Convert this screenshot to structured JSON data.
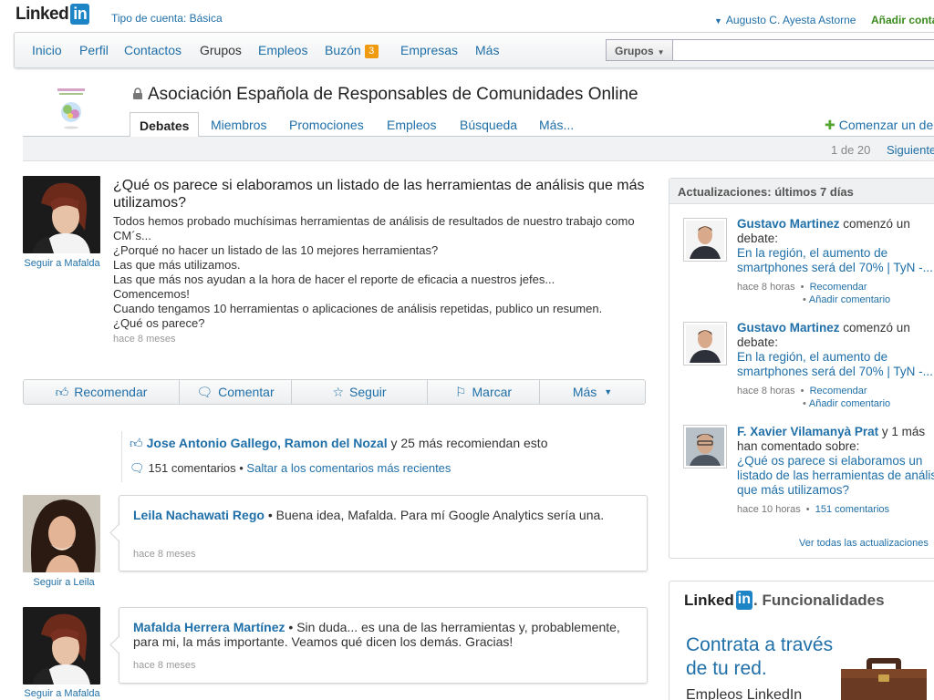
{
  "header": {
    "logo_text": "Linked",
    "logo_in": "in",
    "account_type": "Tipo de cuenta: Básica",
    "user_name": "Augusto C. Ayesta Astorne",
    "add_contacts": "Añadir conta"
  },
  "nav": {
    "items": [
      "Inicio",
      "Perfil",
      "Contactos",
      "Grupos",
      "Empleos",
      "Buzón",
      "Empresas",
      "Más"
    ],
    "inbox_badge": "3",
    "search_scope": "Grupos",
    "search_placeholder": ""
  },
  "group": {
    "title": "Asociación Española de Responsables de Comunidades Online",
    "tabs": [
      "Debates",
      "Miembros",
      "Promociones",
      "Empleos",
      "Búsqueda",
      "Más..."
    ],
    "start_discussion": "Comenzar un deb",
    "pager_count": "1 de 20",
    "pager_next": "Siguiente"
  },
  "discussion": {
    "title": "¿Qué os parece si elaboramos un listado de las herramientas de análisis que más utilizamos?",
    "body": [
      "Todos hemos probado muchísimas herramientas de análisis de resultados de nuestro trabajo como CM´s...",
      "¿Porqué no hacer un listado de las 10 mejores herramientas?",
      "Las que más utilizamos.",
      "Las que más nos ayudan a la hora de hacer el reporte de eficacia a nuestros jefes...",
      "Comencemos!",
      "Cuando tengamos 10 herramientas o aplicaciones de análisis repetidas, publico un resumen.",
      "¿Qué os parece?"
    ],
    "time": "hace 8 meses",
    "follow_author": "Seguir a Mafalda",
    "actions": [
      "Recomendar",
      "Comentar",
      "Seguir",
      "Marcar",
      "Más"
    ],
    "recommenders": "Jose Antonio Gallego, Ramon del Nozal",
    "recommend_suffix": " y 25 más recomiendan esto",
    "comments_count": "151 comentarios",
    "jump_latest": "Saltar a los comentarios más recientes"
  },
  "comments": [
    {
      "author": "Leila Nachawati Rego",
      "text": " • Buena idea, Mafalda. Para mí Google Analytics sería una.",
      "time": "hace 8 meses",
      "follow": "Seguir a Leila"
    },
    {
      "author": "Mafalda Herrera Martínez",
      "text": " • Sin duda... es una de las herramientas y, probablemente, para mi, la más importante. Veamos qué dicen los demás. Gracias!",
      "time": "hace 8 meses",
      "follow": "Seguir a Mafalda"
    }
  ],
  "updates": {
    "header": "Actualizaciones: últimos 7 días",
    "items": [
      {
        "actor": "Gustavo Martinez",
        "action": " comenzó un debate:",
        "link": "En la región, el aumento de smartphones será del 70% | TyN -...",
        "time": "hace 8 horas",
        "recommend": "Recomendar",
        "add_comment": "Añadir comentario"
      },
      {
        "actor": "Gustavo Martinez",
        "action": " comenzó un debate:",
        "link": "En la región, el aumento de smartphones será del 70% | TyN -...",
        "time": "hace 8 horas",
        "recommend": "Recomendar",
        "add_comment": "Añadir comentario"
      },
      {
        "actor": "F. Xavier Vilamanyà Prat",
        "action": " y 1 más han comentado sobre:",
        "link": "¿Qué os parece si elaboramos un listado de las herramientas de análisis que más utilizamos?",
        "time": "hace 10 horas",
        "comments": "151 comentarios"
      }
    ],
    "see_all": "Ver todas las actualizaciones"
  },
  "promo": {
    "logo_text": "Linked",
    "logo_in": "in",
    "logo_rest": ". Funcionalidades",
    "headline": "Contrata a través de tu red.",
    "subline": "Empleos LinkedIn"
  },
  "colors": {
    "link": "#1f6fa8",
    "brand_blue": "#1d84c6",
    "badge_orange": "#f09a0f",
    "green": "#3a8a1d"
  }
}
